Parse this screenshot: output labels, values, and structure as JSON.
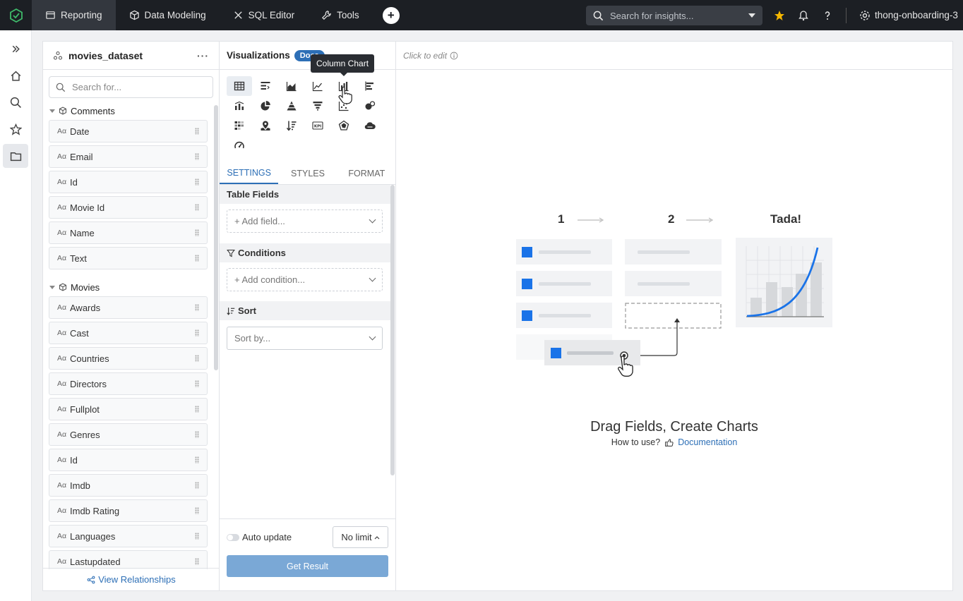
{
  "topnav": {
    "items": [
      {
        "label": "Reporting",
        "icon": "reporting-icon",
        "active": true
      },
      {
        "label": "Data Modeling",
        "icon": "cube-icon"
      },
      {
        "label": "SQL Editor",
        "icon": "sql-icon"
      },
      {
        "label": "Tools",
        "icon": "wrench-icon"
      }
    ],
    "search_placeholder": "Search for insights...",
    "workspace": "thong-onboarding-3"
  },
  "dataset": {
    "name": "movies_dataset",
    "more": "···",
    "search_placeholder": "Search for...",
    "type_label": "Aα",
    "groups": [
      {
        "name": "Comments",
        "fields": [
          "Date",
          "Email",
          "Id",
          "Movie Id",
          "Name",
          "Text"
        ]
      },
      {
        "name": "Movies",
        "fields": [
          "Awards",
          "Cast",
          "Countries",
          "Directors",
          "Fullplot",
          "Genres",
          "Id",
          "Imdb",
          "Imdb Rating",
          "Languages",
          "Lastupdated"
        ]
      }
    ],
    "view_relationships": "View Relationships"
  },
  "viz": {
    "title": "Visualizations",
    "docs_badge": "Docs",
    "tooltip": "Column Chart",
    "tabs": [
      "SETTINGS",
      "STYLES",
      "FORMAT"
    ],
    "table_fields_label": "Table Fields",
    "add_field": "+ Add field...",
    "conditions_label": "Conditions",
    "add_condition": "+ Add condition...",
    "sort_label": "Sort",
    "sort_by": "Sort by...",
    "auto_update": "Auto update",
    "limit": "No limit",
    "get_result": "Get Result"
  },
  "canvas": {
    "click_to_edit": "Click to edit",
    "step1": "1",
    "step2": "2",
    "step3": "Tada!",
    "title": "Drag Fields, Create Charts",
    "how_to_use": "How to use?",
    "documentation": "Documentation"
  },
  "colors": {
    "accent": "#2d6fb6",
    "topbar": "#1c1f24",
    "star": "#f5b700",
    "tile": "#1a73e8"
  }
}
